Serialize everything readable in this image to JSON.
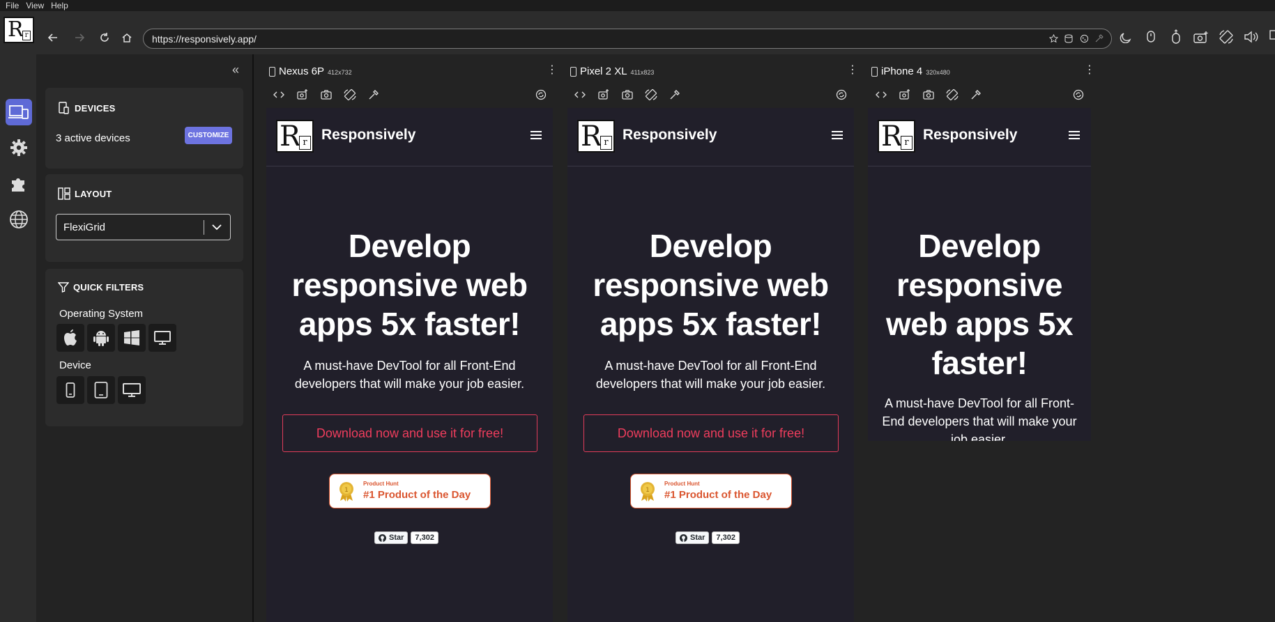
{
  "menu": [
    "File",
    "View",
    "Help"
  ],
  "toolbar": {
    "logo_letter": "R",
    "logo_small": "r",
    "url": "https://responsively.app/"
  },
  "sidebar": {
    "devices_title": "DEVICES",
    "active_devices": "3 active devices",
    "customize_label": "CUSTOMIZE",
    "layout_title": "LAYOUT",
    "layout_value": "FlexiGrid",
    "filters_title": "QUICK FILTERS",
    "os_label": "Operating System",
    "device_label": "Device"
  },
  "devices": [
    {
      "name": "Nexus 6P",
      "resolution": "412x732"
    },
    {
      "name": "Pixel 2 XL",
      "resolution": "411x823"
    },
    {
      "name": "iPhone 4",
      "resolution": "320x480"
    }
  ],
  "site": {
    "brand": "Responsively",
    "logo_letter": "R",
    "logo_small": "r",
    "hero_wide": [
      "Develop",
      "responsive web",
      "apps 5x faster!"
    ],
    "hero_narrow": [
      "Develop",
      "responsive",
      "web apps 5x",
      "faster!"
    ],
    "sub_wide": [
      "A must-have DevTool for all Front-End",
      "developers that will make your job easier."
    ],
    "sub_narrow": [
      "A must-have DevTool for all Front-",
      "End developers that will make your",
      "job easier."
    ],
    "cta": "Download now and use it for free!",
    "ph_small": "Product Hunt",
    "ph_big": "#1 Product of the Day",
    "gh_star": "Star",
    "gh_count": "7,302"
  },
  "colors": {
    "accent": "#5f6ad6",
    "cta_red": "#ef3d5d",
    "product_hunt": "#da552f",
    "screen_bg": "#211f2a"
  }
}
